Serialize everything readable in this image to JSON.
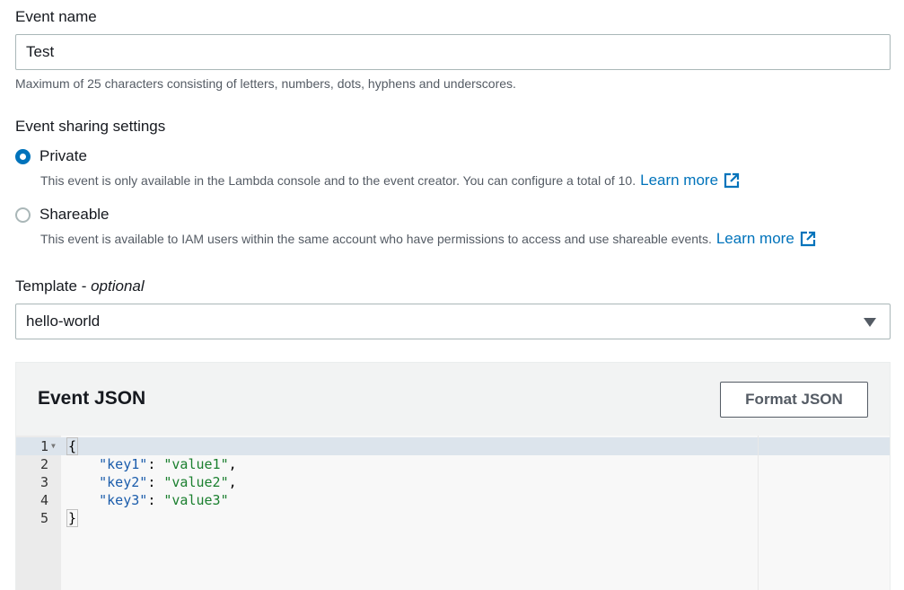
{
  "event_name": {
    "label": "Event name",
    "value": "Test",
    "hint": "Maximum of 25 characters consisting of letters, numbers, dots, hyphens and underscores."
  },
  "sharing": {
    "label": "Event sharing settings",
    "selected": "Private",
    "options": [
      {
        "label": "Private",
        "description": "This event is only available in the Lambda console and to the event creator. You can configure a total of 10.",
        "link": "Learn more"
      },
      {
        "label": "Shareable",
        "description": "This event is available to IAM users within the same account who have permissions to access and use shareable events.",
        "link": "Learn more"
      }
    ]
  },
  "template": {
    "label": "Template",
    "label_separator": " - ",
    "label_optional": "optional",
    "selected": "hello-world"
  },
  "event_json": {
    "title": "Event JSON",
    "format_button": "Format JSON",
    "lines": [
      {
        "num": "1",
        "open": "{"
      },
      {
        "num": "2",
        "key": "\"key1\"",
        "colon": ": ",
        "value": "\"value1\"",
        "comma": ","
      },
      {
        "num": "3",
        "key": "\"key2\"",
        "colon": ": ",
        "value": "\"value2\"",
        "comma": ","
      },
      {
        "num": "4",
        "key": "\"key3\"",
        "colon": ": ",
        "value": "\"value3\"",
        "comma": ""
      },
      {
        "num": "5",
        "close": "}"
      }
    ]
  },
  "icons": {
    "external_link": "external-link-icon",
    "fold": "fold-arrow-icon",
    "dropdown": "caret-down-icon"
  },
  "colors": {
    "accent": "#0073bb",
    "json_key": "#1a5cab",
    "json_value": "#1a7f2e"
  }
}
